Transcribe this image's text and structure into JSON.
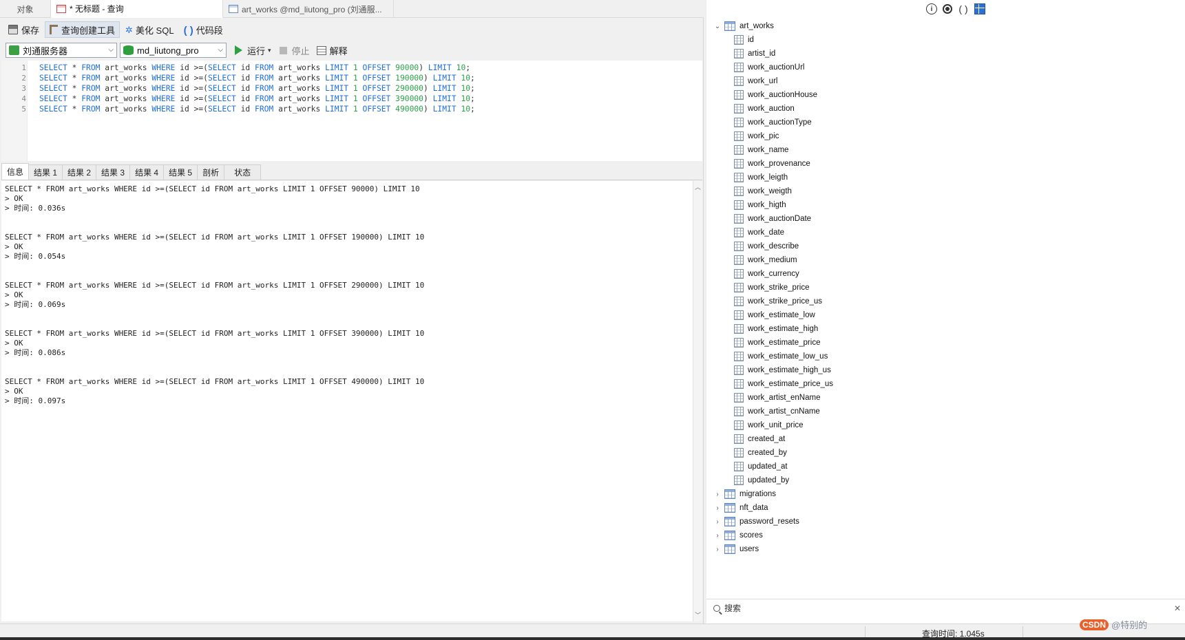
{
  "tabs": [
    {
      "label": "对象"
    },
    {
      "label": "* 无标题 - 查询"
    },
    {
      "label": "art_works @md_liutong_pro (刘通服..."
    }
  ],
  "toolbar": {
    "save_label": "保存",
    "query_builder_label": "查询创建工具",
    "beautify_label": "美化 SQL",
    "snippet_label": "代码段"
  },
  "connection": {
    "server": "刘通服务器",
    "database": "md_liutong_pro",
    "run_label": "运行",
    "stop_label": "停止",
    "explain_label": "解释"
  },
  "editor": {
    "line_numbers": [
      "1",
      "2",
      "3",
      "4",
      "5"
    ],
    "lines": [
      {
        "prefix": "SELECT * FROM art_works WHERE id >=(SELECT id FROM art_works LIMIT 1 OFFSET ",
        "offset": "90000",
        "suffix": ") LIMIT 10;"
      },
      {
        "prefix": "SELECT * FROM art_works WHERE id >=(SELECT id FROM art_works LIMIT 1 OFFSET ",
        "offset": "190000",
        "suffix": ") LIMIT 10;"
      },
      {
        "prefix": "SELECT * FROM art_works WHERE id >=(SELECT id FROM art_works LIMIT 1 OFFSET ",
        "offset": "290000",
        "suffix": ") LIMIT 10;"
      },
      {
        "prefix": "SELECT * FROM art_works WHERE id >=(SELECT id FROM art_works LIMIT 1 OFFSET ",
        "offset": "390000",
        "suffix": ") LIMIT 10;"
      },
      {
        "prefix": "SELECT * FROM art_works WHERE id >=(SELECT id FROM art_works LIMIT 1 OFFSET ",
        "offset": "490000",
        "suffix": ") LIMIT 10;"
      }
    ]
  },
  "result_tabs": [
    "信息",
    "结果 1",
    "结果 2",
    "结果 3",
    "结果 4",
    "结果 5",
    "剖析",
    "状态"
  ],
  "output": [
    {
      "sql": "SELECT * FROM art_works WHERE id >=(SELECT id FROM art_works LIMIT 1 OFFSET 90000) LIMIT 10",
      "ok": "> OK",
      "time": "> 时间: 0.036s"
    },
    {
      "sql": "SELECT * FROM art_works WHERE id >=(SELECT id FROM art_works LIMIT 1 OFFSET 190000) LIMIT 10",
      "ok": "> OK",
      "time": "> 时间: 0.054s"
    },
    {
      "sql": "SELECT * FROM art_works WHERE id >=(SELECT id FROM art_works LIMIT 1 OFFSET 290000) LIMIT 10",
      "ok": "> OK",
      "time": "> 时间: 0.069s"
    },
    {
      "sql": "SELECT * FROM art_works WHERE id >=(SELECT id FROM art_works LIMIT 1 OFFSET 390000) LIMIT 10",
      "ok": "> OK",
      "time": "> 时间: 0.086s"
    },
    {
      "sql": "SELECT * FROM art_works WHERE id >=(SELECT id FROM art_works LIMIT 1 OFFSET 490000) LIMIT 10",
      "ok": "> OK",
      "time": "> 时间: 0.097s"
    }
  ],
  "tree": {
    "table": "art_works",
    "columns": [
      "id",
      "artist_id",
      "work_auctionUrl",
      "work_url",
      "work_auctionHouse",
      "work_auction",
      "work_auctionType",
      "work_pic",
      "work_name",
      "work_provenance",
      "work_leigth",
      "work_weigth",
      "work_higth",
      "work_auctionDate",
      "work_date",
      "work_describe",
      "work_medium",
      "work_currency",
      "work_strike_price",
      "work_strike_price_us",
      "work_estimate_low",
      "work_estimate_high",
      "work_estimate_price",
      "work_estimate_low_us",
      "work_estimate_high_us",
      "work_estimate_price_us",
      "work_artist_enName",
      "work_artist_cnName",
      "work_unit_price",
      "created_at",
      "created_by",
      "updated_at",
      "updated_by"
    ],
    "other_tables": [
      "migrations",
      "nft_data",
      "password_resets",
      "scores",
      "users"
    ]
  },
  "search": {
    "placeholder": "搜索"
  },
  "status": {
    "query_time": "查询时间: 1.045s"
  },
  "watermark": {
    "logo": "CSDN",
    "text": "@特别的"
  }
}
